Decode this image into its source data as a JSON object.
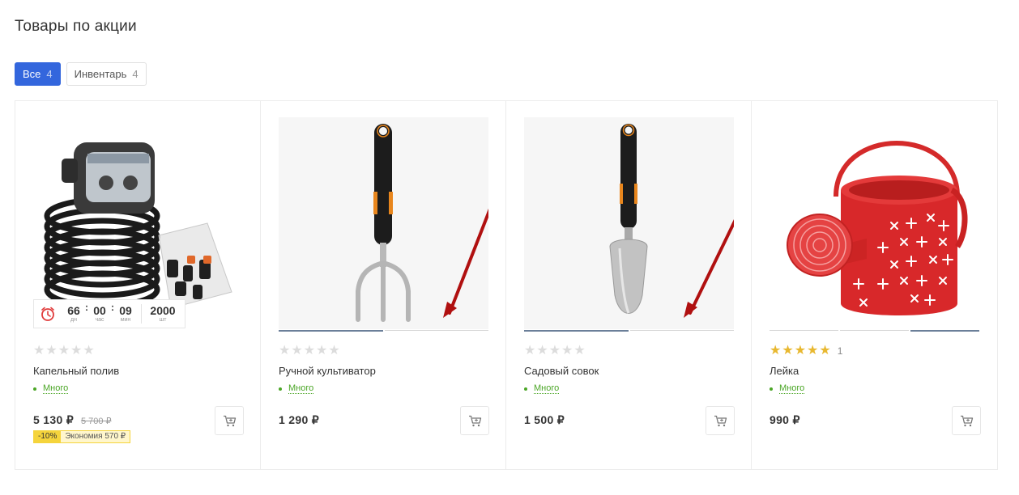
{
  "title": "Товары по акции",
  "filters": [
    {
      "label": "Все",
      "count": "4",
      "active": true
    },
    {
      "label": "Инвентарь",
      "count": "4",
      "active": false
    }
  ],
  "products": [
    {
      "name": "Капельный полив",
      "image_icon": "drip-irrigation-kit-image",
      "rating": 0,
      "review_count": "",
      "stock": "Много",
      "price": "5 130 ₽",
      "old_price": "5 700 ₽",
      "discount_percent": "-10%",
      "discount_saving": "Экономия 570 ₽",
      "timer": {
        "days": "66",
        "days_label": "дн",
        "hours": "00",
        "hours_label": "час",
        "minutes": "09",
        "minutes_label": "мин",
        "quantity": "2000",
        "quantity_label": "шт"
      }
    },
    {
      "name": "Ручной культиватор",
      "image_icon": "hand-cultivator-image",
      "rating": 0,
      "review_count": "",
      "stock": "Много",
      "price": "1 290 ₽"
    },
    {
      "name": "Садовый совок",
      "image_icon": "garden-trowel-image",
      "rating": 0,
      "review_count": "",
      "stock": "Много",
      "price": "1 500 ₽"
    },
    {
      "name": "Лейка",
      "image_icon": "watering-can-image",
      "rating": 5,
      "review_count": "1",
      "stock": "Много",
      "price": "990 ₽"
    }
  ],
  "colors": {
    "accent": "#3366dd",
    "stock": "#4ba626",
    "star": "#e8b830",
    "discount": "#f5d43c",
    "arrow": "#b01010"
  }
}
